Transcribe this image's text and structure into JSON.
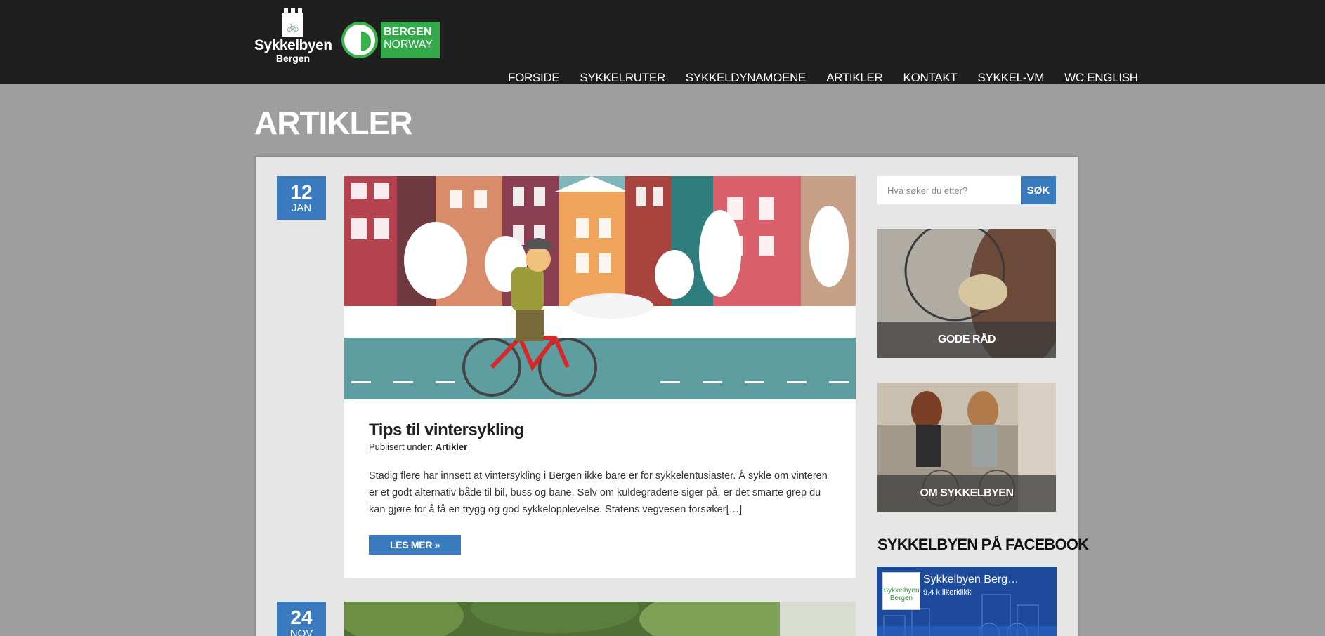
{
  "header": {
    "logo": {
      "name": "Sykkelbyen",
      "city": "Bergen"
    },
    "badge": {
      "line1": "BERGEN",
      "line2": "NORWAY"
    },
    "nav": [
      {
        "label": "FORSIDE"
      },
      {
        "label": "SYKKELRUTER"
      },
      {
        "label": "SYKKELDYNAMOENE"
      },
      {
        "label": "ARTIKLER"
      },
      {
        "label": "KONTAKT"
      },
      {
        "label": "SYKKEL-VM"
      },
      {
        "label": "WC ENGLISH"
      }
    ]
  },
  "page": {
    "title": "ARTIKLER"
  },
  "posts": [
    {
      "day": "12",
      "month": "JAN",
      "title": "Tips til vintersykling",
      "meta_prefix": "Publisert under:",
      "category": "Artikler",
      "excerpt": "Stadig flere har innsett at vintersykling i Bergen ikke bare er for sykkelentusiaster. Å sykle om vinteren er et godt alternativ både til bil, buss og bane. Selv om kuldegradene siger på, er det smarte grep du kan gjøre for å få en trygg og god sykkelopplevelse. Statens vegvesen forsøker[…]",
      "readmore": "LES MER »"
    },
    {
      "day": "24",
      "month": "NOV"
    }
  ],
  "sidebar": {
    "search": {
      "placeholder": "Hva søker du etter?",
      "button": "SØK"
    },
    "tiles": [
      {
        "label": "GODE RÅD"
      },
      {
        "label": "OM SYKKELBYEN"
      }
    ],
    "facebook": {
      "heading": "SYKKELBYEN PÅ FACEBOOK",
      "page_name": "Sykkelbyen Berg…",
      "likes": "9,4 k likerklikk",
      "logo_name": "Sykkelbyen",
      "logo_city": "Bergen"
    }
  }
}
